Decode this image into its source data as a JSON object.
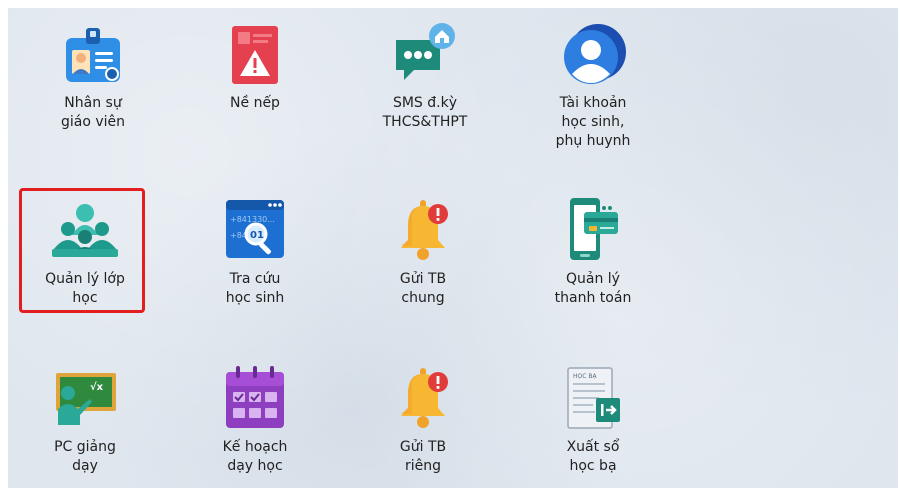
{
  "tiles": [
    {
      "id": "nhan-su",
      "line1": "Nhân sự",
      "line2": "giáo viên",
      "line3": "",
      "icon": "staff-badge-icon"
    },
    {
      "id": "ne-nep",
      "line1": "Nề nếp",
      "line2": "",
      "line3": "",
      "icon": "warning-document-icon"
    },
    {
      "id": "sms",
      "line1": "SMS đ.kỳ",
      "line2": "THCS&THPT",
      "line3": "",
      "icon": "sms-chat-icon"
    },
    {
      "id": "tai-khoan",
      "line1": "Tài khoản",
      "line2": "học sinh,",
      "line3": "phụ huynh",
      "icon": "user-account-icon"
    },
    {
      "id": "quan-ly-lop",
      "line1": "Quản lý lớp",
      "line2": "học",
      "line3": "",
      "icon": "classroom-group-icon"
    },
    {
      "id": "tra-cuu",
      "line1": "Tra cứu",
      "line2": "học sinh",
      "line3": "",
      "icon": "student-lookup-icon"
    },
    {
      "id": "gui-tb-chung",
      "line1": "Gửi TB",
      "line2": "chung",
      "line3": "",
      "icon": "bell-notification-icon"
    },
    {
      "id": "quan-ly-tt",
      "line1": "Quản lý",
      "line2": "thanh toán",
      "line3": "",
      "icon": "payment-phone-icon"
    },
    {
      "id": "pc-giang-day",
      "line1": "PC giảng",
      "line2": "dạy",
      "line3": "",
      "icon": "teacher-board-icon"
    },
    {
      "id": "ke-hoach",
      "line1": "Kế hoạch",
      "line2": "dạy học",
      "line3": "",
      "icon": "calendar-plan-icon"
    },
    {
      "id": "gui-tb-rieng",
      "line1": "Gửi TB",
      "line2": "riêng",
      "line3": "",
      "icon": "bell-notification-icon"
    },
    {
      "id": "xuat-so",
      "line1": "Xuất sổ",
      "line2": "học bạ",
      "line3": "",
      "icon": "export-report-icon"
    }
  ],
  "icon_text": {
    "tra_cuu_numbers_1": "+841330...",
    "tra_cuu_numbers_2": "+84",
    "tra_cuu_numbers_3": "01",
    "hoc_ba_doc": "HỌC BẠ",
    "sqrt_symbol": "√x"
  },
  "colors": {
    "highlight_border": "#e21e1e",
    "text": "#222222"
  },
  "selected_tile": "quan-ly-lop"
}
